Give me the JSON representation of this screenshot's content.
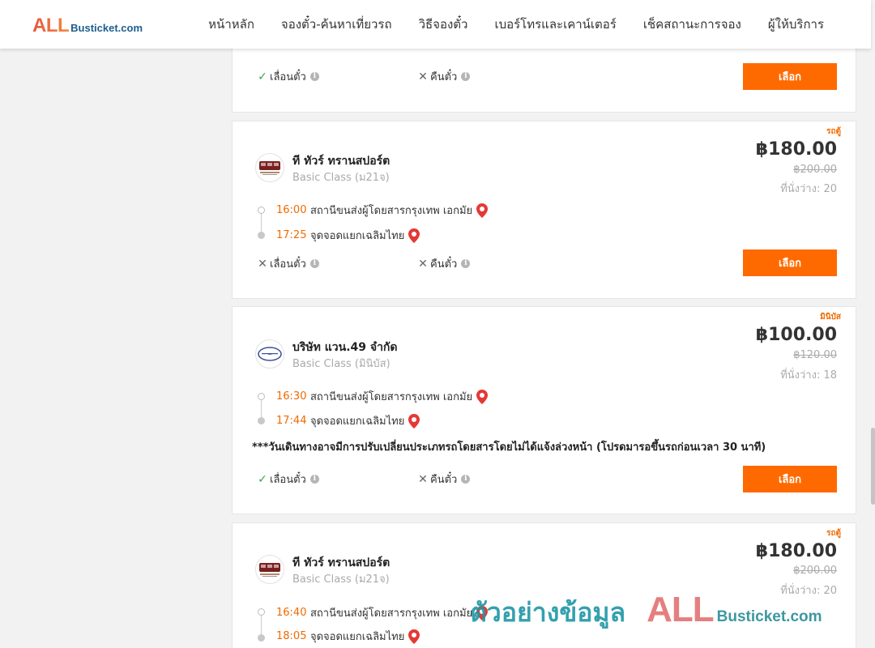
{
  "header": {
    "logo_all": "ALL",
    "logo_site": "Busticket.com",
    "nav": [
      "หน้าหลัก",
      "จองตั๋ว-ค้นหาเที่ยวรถ",
      "วิธีจองตั๋ว",
      "เบอร์โทรและเคาน์เตอร์",
      "เช็คสถานะการจอง",
      "ผู้ให้บริการ"
    ]
  },
  "labels": {
    "reschedule": "เลื่อนตั๋ว",
    "refund": "คืนตั๋ว",
    "select": "เลือก",
    "info": "i"
  },
  "trips": [
    {
      "reschedule_allowed": true,
      "refund_allowed": false
    },
    {
      "bus_type": "รถตู้",
      "operator": "ที ทัวร์ ทรานสปอร์ต",
      "class": "Basic Class (ม21จ)",
      "price": "฿180.00",
      "old_price": "฿200.00",
      "seats": "ที่นั่งว่าง: 20",
      "depart_time": "16:00",
      "depart_place": "สถานีขนส่งผู้โดยสารกรุงเทพ เอกมัย",
      "arrive_time": "17:25",
      "arrive_place": "จุดจอดแยกเฉลิมไทย",
      "reschedule_allowed": false,
      "refund_allowed": false
    },
    {
      "bus_type": "มินิบัส",
      "operator": "บริษัท แวน.49 จำกัด",
      "class": "Basic Class (มินิบัส)",
      "price": "฿100.00",
      "old_price": "฿120.00",
      "seats": "ที่นั่งว่าง: 18",
      "depart_time": "16:30",
      "depart_place": "สถานีขนส่งผู้โดยสารกรุงเทพ เอกมัย",
      "arrive_time": "17:44",
      "arrive_place": "จุดจอดแยกเฉลิมไทย",
      "notice": "***วันเดินทางอาจมีการปรับเปลี่ยนประเภทรถโดยสารโดยไม่ได้แจ้งล่วงหน้า (โปรดมารอขึ้นรถก่อนเวลา 30 นาที)",
      "reschedule_allowed": true,
      "refund_allowed": false
    },
    {
      "bus_type": "รถตู้",
      "operator": "ที ทัวร์ ทรานสปอร์ต",
      "class": "Basic Class (ม21จ)",
      "price": "฿180.00",
      "old_price": "฿200.00",
      "seats": "ที่นั่งว่าง: 20",
      "depart_time": "16:40",
      "depart_place": "สถานีขนส่งผู้โดยสารกรุงเทพ เอกมัย",
      "arrive_time": "18:05",
      "arrive_place": "จุดจอดแยกเฉลิมไทย"
    }
  ],
  "watermark": {
    "text": "ตัวอย่างข้อมูล",
    "all": "ALL",
    "site": "Busticket.com"
  },
  "colors": {
    "accent": "#ff6a00",
    "time": "#f06a00",
    "ok": "#3aa845",
    "pin": "#e53935"
  }
}
